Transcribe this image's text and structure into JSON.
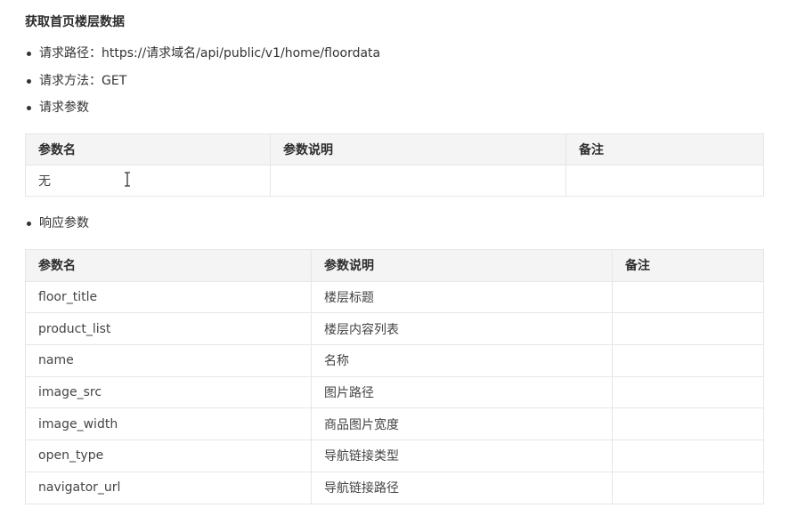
{
  "page": {
    "title": "获取首页楼层数据"
  },
  "info": {
    "url_line": "请求路径：https://请求域名/api/public/v1/home/floordata",
    "method_line": "请求方法：GET",
    "params_line": "请求参数",
    "response_line": "响应参数"
  },
  "request_table": {
    "headers": [
      "参数名",
      "参数说明",
      "备注"
    ],
    "rows": [
      [
        "无",
        "",
        ""
      ]
    ]
  },
  "response_table": {
    "headers": [
      "参数名",
      "参数说明",
      "备注"
    ],
    "rows": [
      [
        "floor_title",
        "楼层标题",
        ""
      ],
      [
        "product_list",
        "楼层内容列表",
        ""
      ],
      [
        "name",
        "名称",
        ""
      ],
      [
        "image_src",
        "图片路径",
        ""
      ],
      [
        "image_width",
        "商品图片宽度",
        ""
      ],
      [
        "open_type",
        "导航链接类型",
        ""
      ],
      [
        "navigator_url",
        "导航链接路径",
        ""
      ]
    ]
  },
  "icons": {
    "cursor": "text-cursor-icon"
  }
}
